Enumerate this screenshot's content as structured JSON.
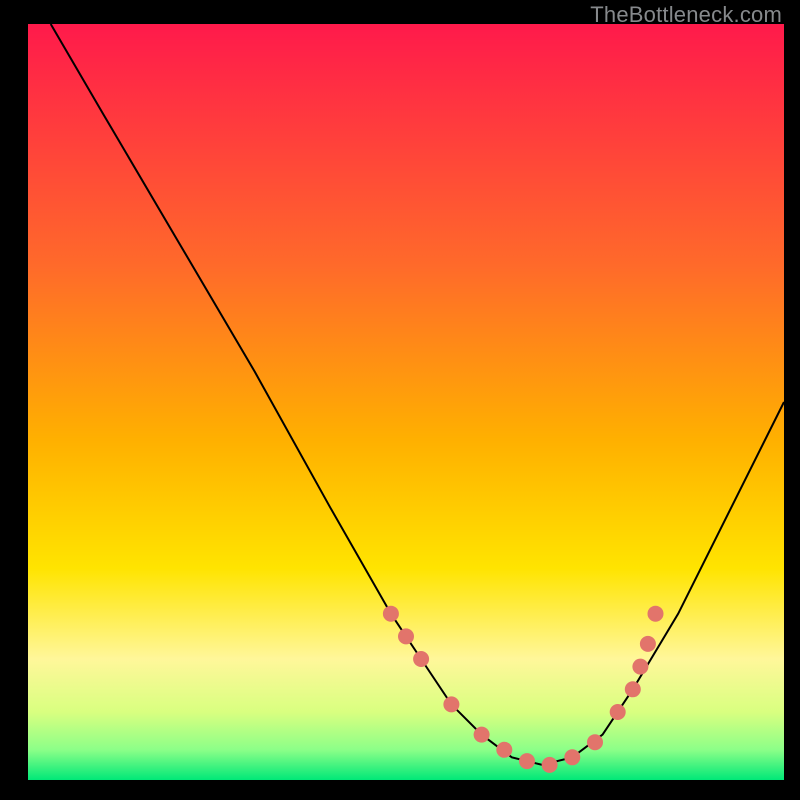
{
  "watermark": "TheBottleneck.com",
  "colors": {
    "bg": "#000000",
    "curve": "#000000",
    "marker_fill": "#e2746b",
    "marker_stroke": "#e2746b",
    "grad_top": "#ff1a4b",
    "grad_mid": "#ffd400",
    "grad_low": "#d9ff66",
    "grad_bot": "#00e878"
  },
  "chart_data": {
    "type": "line",
    "title": "",
    "xlabel": "",
    "ylabel": "",
    "xlim": [
      0,
      100
    ],
    "ylim": [
      0,
      100
    ],
    "series": [
      {
        "name": "curve",
        "x": [
          3,
          10,
          20,
          30,
          40,
          48,
          52,
          56,
          60,
          64,
          68,
          72,
          76,
          80,
          86,
          93,
          100
        ],
        "y": [
          100,
          88,
          71,
          54,
          36,
          22,
          16,
          10,
          6,
          3,
          2,
          3,
          6,
          12,
          22,
          36,
          50
        ],
        "_comment": "V-shaped bottleneck curve; y is % mismatch, minimum ≈ 2 near x ≈ 68"
      }
    ],
    "markers": {
      "name": "highlighted-points",
      "x": [
        48,
        50,
        52,
        56,
        60,
        63,
        66,
        69,
        72,
        75,
        78,
        80,
        81,
        82,
        83
      ],
      "y": [
        22,
        19,
        16,
        10,
        6,
        4,
        2.5,
        2,
        3,
        5,
        9,
        12,
        15,
        18,
        22
      ]
    },
    "gradient_bands": [
      {
        "y_from": 100,
        "y_to": 25,
        "from": "#ff1a4b",
        "to": "#ffd400"
      },
      {
        "y_from": 25,
        "y_to": 12,
        "from": "#ffd400",
        "to": "#fff79a"
      },
      {
        "y_from": 12,
        "y_to": 5,
        "from": "#fff79a",
        "to": "#b8ff7a"
      },
      {
        "y_from": 5,
        "y_to": 0,
        "from": "#b8ff7a",
        "to": "#00e878"
      }
    ]
  }
}
